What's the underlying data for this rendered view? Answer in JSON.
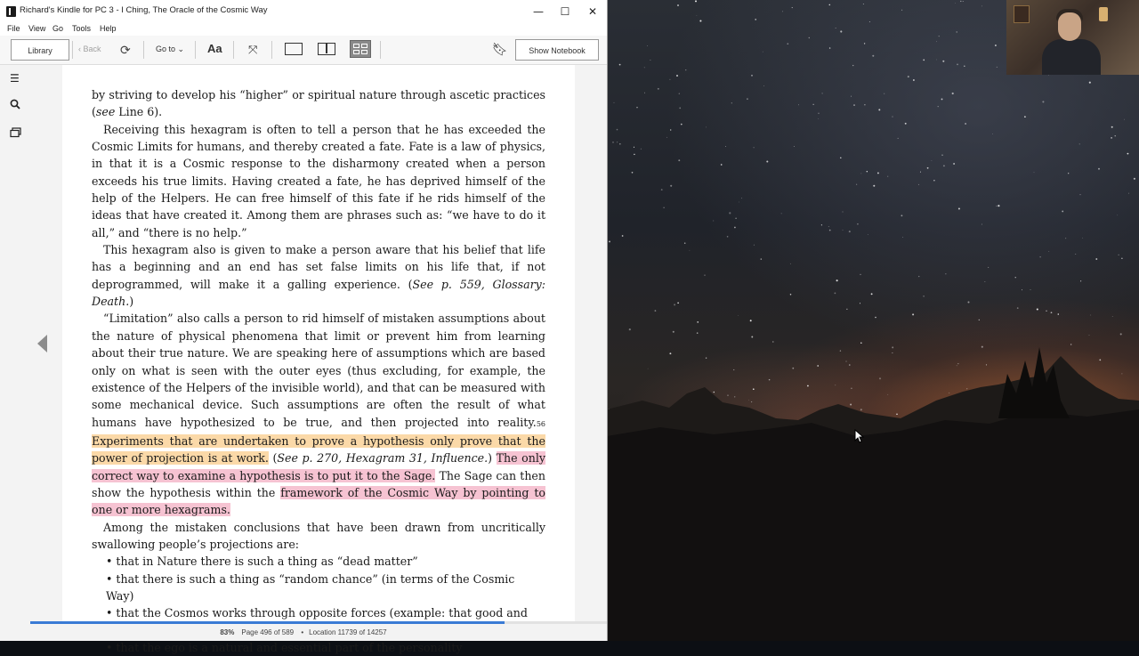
{
  "window": {
    "title": "Richard's Kindle for PC 3 - I Ching, The Oracle of the Cosmic Way",
    "minimize": "—",
    "maximize": "☐",
    "close": "✕"
  },
  "menu": [
    "File",
    "View",
    "Go",
    "Tools",
    "Help"
  ],
  "toolbar": {
    "library": "Library",
    "back": "Back",
    "goto": "Go to",
    "font": "Aa",
    "show_notebook": "Show Notebook"
  },
  "content": {
    "p1": "by striving to develop his “higher” or spiritual nature through ascetic practices (",
    "p1_see": "see",
    "p1_end": " Line 6).",
    "p2": "Receiving this hexagram is often to tell a person that he has exceeded the Cosmic Limits for humans, and thereby created a fate. Fate is a law of physics, in that it is a Cosmic response to the disharmony created when a person exceeds his true limits. Having created a fate, he has deprived himself of the help of the Helpers. He can free himself of this fate if he rids himself of the ideas that have created it. Among them are phrases such as: “we have to do it all,” and “there is no help.”",
    "p3_a": "This hexagram also is given to make a person aware that his belief that life has a beginning and an end has set false limits on his life that, if not deprogrammed, will make it a galling experience. (",
    "p3_ref": "See p. 559, Glossary: Death.",
    "p3_b": ")",
    "p4_a": "“Limitation” also calls a person to rid himself of mistaken assumptions about the nature of physical phenomena that limit or prevent him from learning about their true nature. We are speaking here of assumptions which are based only on what is seen with the outer eyes (thus excluding, for example, the existence of the Helpers of the invisible world), and that can be measured with some mechanical device. Such assumptions are often the result of what humans have hypothesized to be true, and then projected into reality.",
    "p4_note": "56",
    "p4_hl1": "Experiments that are undertaken to prove a hypothesis only prove that the power of projection is at work.",
    "p4_b": " (",
    "p4_ref": "See p. 270, Hexagram 31, Influence.",
    "p4_c": ") ",
    "p4_hl2": "The only correct way to examine a hypothesis is to put it to the Sage.",
    "p4_d": " The Sage can then show the hypothesis within the ",
    "p4_hl3": "framework of the Cosmic Way by pointing to one or more hexagrams.",
    "p5": "Among the mistaken conclusions that have been drawn from uncritically swallowing people’s projections are:",
    "bullets": [
      "• that in Nature there is such a thing as “dead matter”",
      "• that there is such a thing as “random chance” (in terms of the Cosmic Way)",
      "• that the Cosmos works through opposite forces (example: that good and evil are both parts of the Cosmos, and that good fights the evil)",
      "• that the ego is a natural and essential part of the personality"
    ]
  },
  "status": {
    "percent": "83%",
    "page": "Page 496 of 589",
    "dot": "•",
    "location": "Location 11739 of 14257",
    "progress_fraction": 0.823
  },
  "colors": {
    "highlight_orange": "#fbd9a8",
    "highlight_pink": "#f6c3d2",
    "progress": "#3a7bd5"
  }
}
